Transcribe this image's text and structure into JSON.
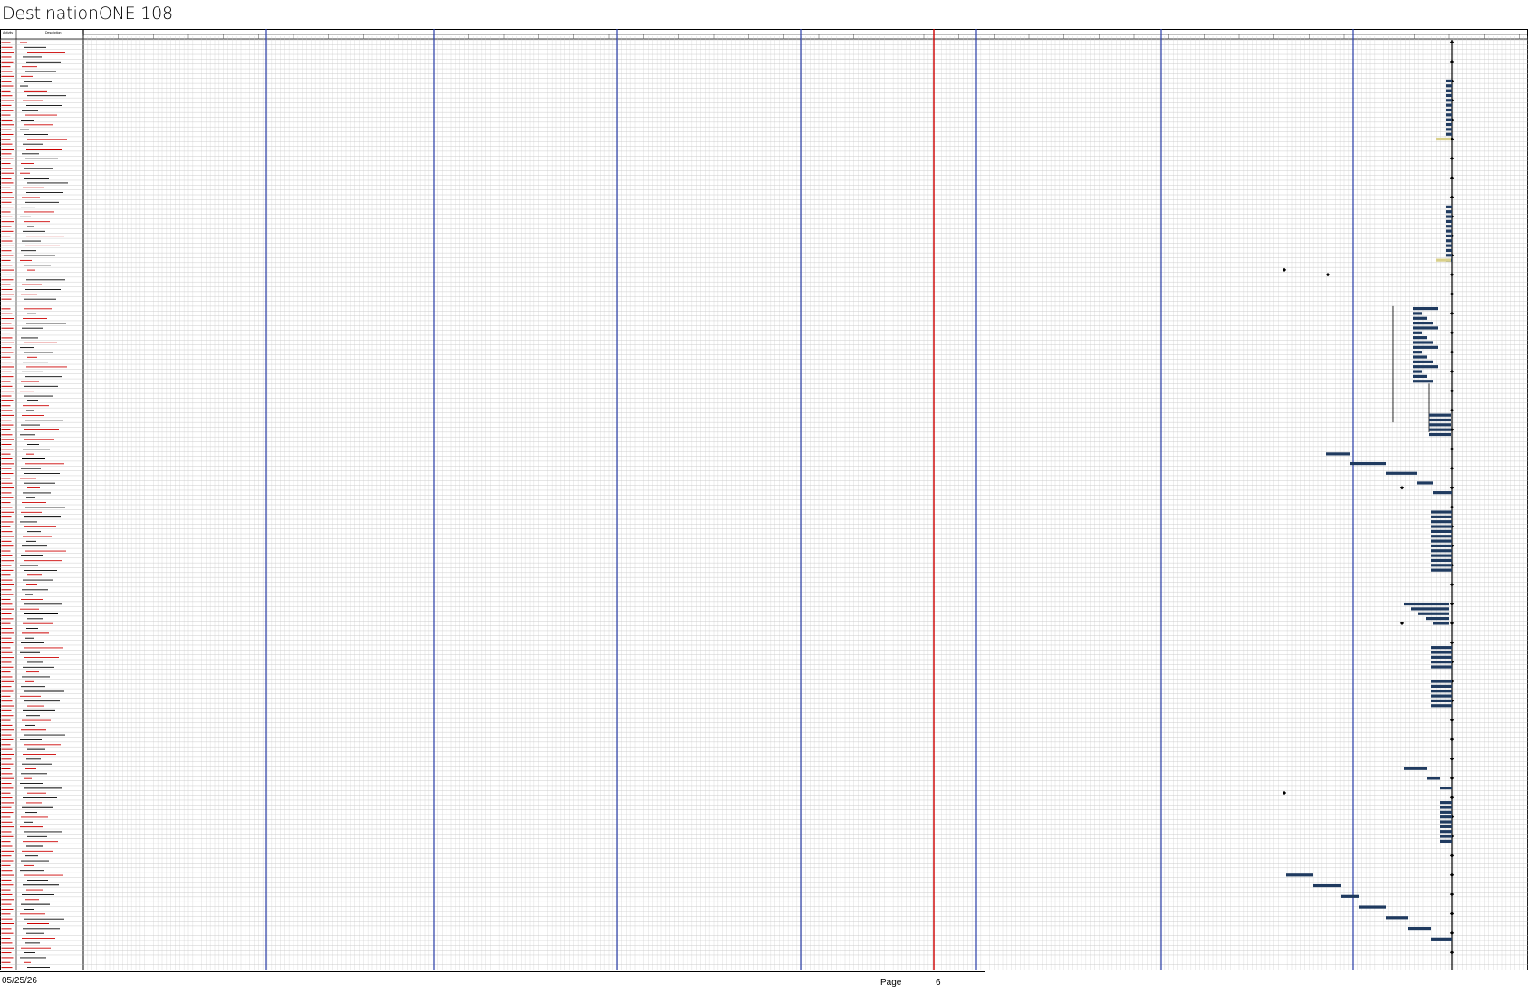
{
  "header": {
    "title": "DestinationONE 108"
  },
  "table": {
    "columns": [
      "Activity",
      "Description"
    ],
    "row_count": 192,
    "id_color": "#cc0000",
    "desc_colors": [
      "#cc0000",
      "#000000"
    ]
  },
  "timeline": {
    "minor_columns": 330,
    "major_ticks_every": 8,
    "separator_color": "#2a3ea8",
    "data_date_color": "#cc0000",
    "bar_color": "#1f3a5f",
    "summary_color": "#000000",
    "highlight_color": "#d9d08a"
  },
  "footer": {
    "date": "05/25/26",
    "page_label": "Page",
    "page_number": "6"
  }
}
